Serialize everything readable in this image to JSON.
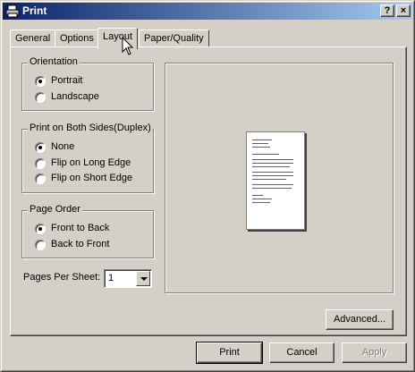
{
  "window": {
    "title": "Print",
    "help_label": "?",
    "close_label": "×"
  },
  "tabs": [
    {
      "label": "General"
    },
    {
      "label": "Options"
    },
    {
      "label": "Layout"
    },
    {
      "label": "Paper/Quality"
    }
  ],
  "orientation": {
    "label": "Orientation",
    "options": [
      {
        "label": "Portrait",
        "checked": true
      },
      {
        "label": "Landscape",
        "checked": false
      }
    ]
  },
  "duplex": {
    "label": "Print on Both Sides(Duplex)",
    "options": [
      {
        "label": "None",
        "checked": true
      },
      {
        "label": "Flip on Long Edge",
        "checked": false
      },
      {
        "label": "Flip on Short Edge",
        "checked": false
      }
    ]
  },
  "page_order": {
    "label": "Page Order",
    "options": [
      {
        "label": "Front to Back",
        "checked": true
      },
      {
        "label": "Back to Front",
        "checked": false
      }
    ]
  },
  "pages_per_sheet": {
    "label": "Pages Per Sheet:",
    "value": "1"
  },
  "buttons": {
    "advanced": "Advanced...",
    "print": "Print",
    "cancel": "Cancel",
    "apply": "Apply"
  }
}
